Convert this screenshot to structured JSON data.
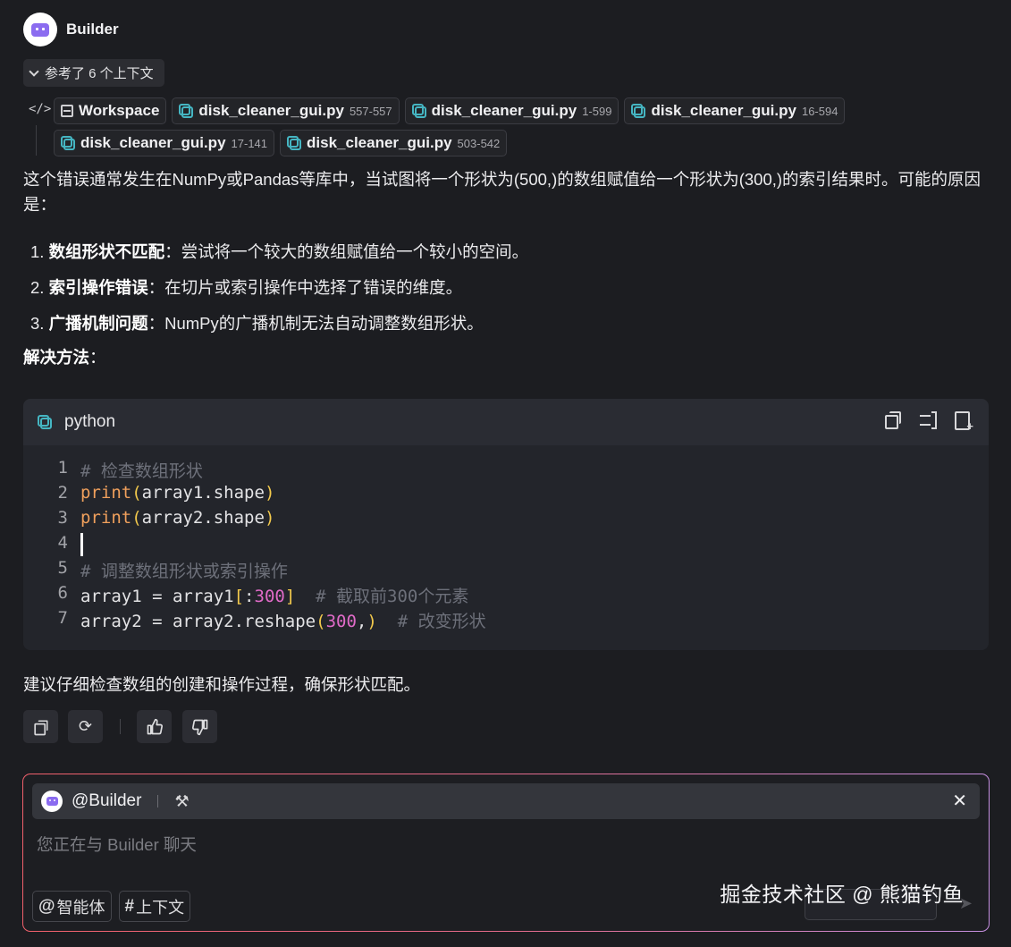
{
  "header": {
    "bot_name": "Builder"
  },
  "context": {
    "toggle_label": "参考了 6 个上下文",
    "workspace_label": "Workspace",
    "files": [
      {
        "name": "disk_cleaner_gui.py",
        "range": "557-557"
      },
      {
        "name": "disk_cleaner_gui.py",
        "range": "1-599"
      },
      {
        "name": "disk_cleaner_gui.py",
        "range": "16-594"
      },
      {
        "name": "disk_cleaner_gui.py",
        "range": "17-141"
      },
      {
        "name": "disk_cleaner_gui.py",
        "range": "503-542"
      }
    ]
  },
  "message": {
    "intro": "这个错误通常发生在NumPy或Pandas等库中，当试图将一个形状为(500,)的数组赋值给一个形状为(300,)的索引结果时。可能的原因是：",
    "reasons": [
      {
        "num": "1.",
        "title": "数组形状不匹配",
        "desc": "：尝试将一个较大的数组赋值给一个较小的空间。"
      },
      {
        "num": "2.",
        "title": "索引操作错误",
        "desc": "：在切片或索引操作中选择了错误的维度。"
      },
      {
        "num": "3.",
        "title": "广播机制问题",
        "desc": "：NumPy的广播机制无法自动调整数组形状。"
      }
    ],
    "solution_title": "解决方法",
    "solution_colon": "：",
    "advice": "建议仔细检查数组的创建和操作过程，确保形状匹配。"
  },
  "code": {
    "language": "python",
    "line_numbers": [
      "1",
      "2",
      "3",
      "4",
      "5",
      "6",
      "7"
    ],
    "comment_1": "# 检查数组形状",
    "print_kw": "print",
    "paren_open": "(",
    "paren_close": ")",
    "arg_1": "array1.shape",
    "arg_2": "array2.shape",
    "comment_5": "# 调整数组形状或索引操作",
    "l6_lhs": "array1 = array1",
    "l6_bracket_open": "[",
    "l6_colon": ":",
    "l6_num": "300",
    "l6_bracket_close": "]",
    "l6_comment": "# 截取前300个元素",
    "l7_lhs": "array2 = array2.reshape",
    "l7_num": "300",
    "l7_comma": ",",
    "l7_comment": "# 改变形状"
  },
  "chat_input": {
    "mention": "@Builder",
    "placeholder": "您正在与 Builder 聊天",
    "agent_symbol": "@",
    "agent_label": "智能体",
    "context_symbol": "#",
    "context_label": "上下文",
    "watermark": "掘金技术社区 @ 熊猫钓鱼"
  },
  "icons": {
    "copy": "copy-icon",
    "regenerate": "refresh-icon",
    "like": "thumbs-up-icon",
    "dislike": "thumbs-down-icon",
    "close": "close-icon",
    "hammer": "hammer-icon"
  },
  "colors": {
    "background": "#1c1d21",
    "python_icon": "#45b6c3",
    "code_function": "#f0a05c",
    "code_paren": "#f2c94c",
    "code_number": "#e06bc8",
    "code_comment": "#6d707a",
    "input_border_start": "#f0606b",
    "input_border_end": "#c58fe0"
  }
}
